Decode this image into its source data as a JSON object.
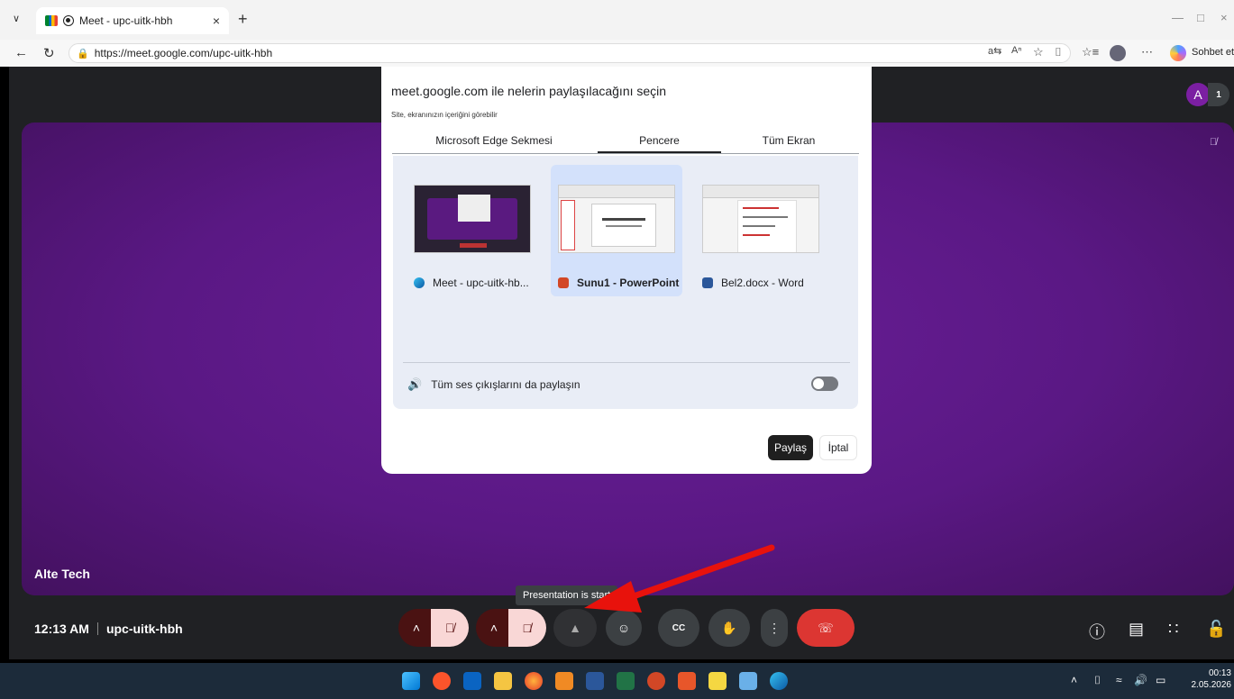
{
  "browser": {
    "tab_title": "Meet - upc-uitk-hbh",
    "url": "https://meet.google.com/upc-uitk-hbh",
    "copilot_label": "Sohbet et"
  },
  "meet": {
    "participant_name": "Alte Tech",
    "time": "12:13 AM",
    "meeting_code": "upc-uitk-hbh",
    "avatar_initial": "A",
    "participant_count": "1",
    "tooltip": "Presentation is start"
  },
  "dialog": {
    "title": "meet.google.com ile nelerin paylaşılacağını seçin",
    "subtitle": "Site, ekranınızın içeriğini görebilir",
    "tabs": [
      {
        "label": "Microsoft Edge Sekmesi"
      },
      {
        "label": "Pencere"
      },
      {
        "label": "Tüm Ekran"
      }
    ],
    "sources": [
      {
        "label": "Meet - upc-uitk-hb..."
      },
      {
        "label": "Sunu1 - PowerPoint"
      },
      {
        "label": "Bel2.docx - Word"
      }
    ],
    "audio_label": "Tüm ses çıkışlarını da paylaşın",
    "share_button": "Paylaş",
    "cancel_button": "İptal"
  },
  "taskbar": {
    "time": "00:13",
    "date": "2.05.2026"
  },
  "colors": {
    "tile_purple": "#5a1884",
    "end_call_red": "#dc3632",
    "arrow_red": "#e8120c"
  }
}
